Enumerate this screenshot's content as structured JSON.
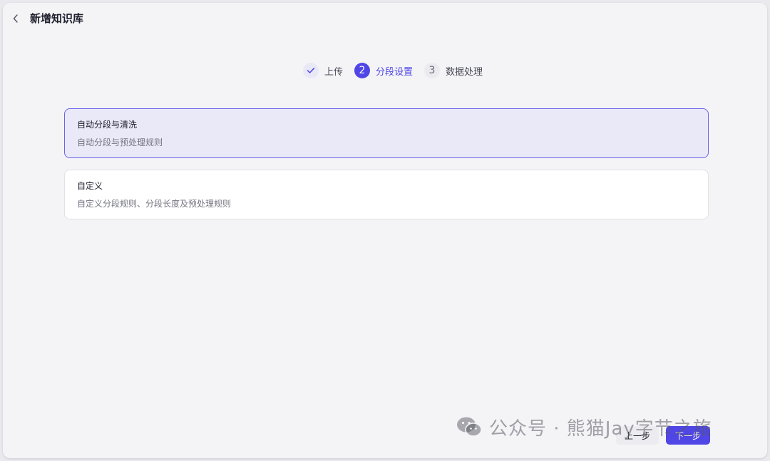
{
  "header": {
    "title": "新增知识库",
    "back_icon": "chevron-left-icon"
  },
  "steps": [
    {
      "number": "1",
      "label": "上传",
      "state": "done"
    },
    {
      "number": "2",
      "label": "分段设置",
      "state": "active"
    },
    {
      "number": "3",
      "label": "数据处理",
      "state": "todo"
    }
  ],
  "options": [
    {
      "title": "自动分段与清洗",
      "description": "自动分段与预处理规则",
      "selected": true
    },
    {
      "title": "自定义",
      "description": "自定义分段规则、分段长度及预处理规则",
      "selected": false
    }
  ],
  "footer": {
    "prev_label": "上一步",
    "next_label": "下一步"
  },
  "watermark": {
    "text": "公众号 · 熊猫Jay字节之旅"
  },
  "colors": {
    "accent": "#4f46e5",
    "selected_bg": "#e9e9f8",
    "page_bg": "#f4f4f7"
  }
}
